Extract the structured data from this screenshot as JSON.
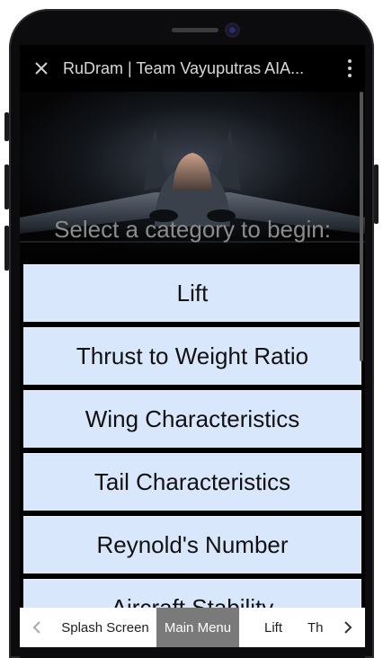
{
  "app_bar": {
    "title": "RuDram | Team Vayuputras AIA...",
    "close_icon": "close-icon",
    "menu_icon": "more-vert-icon"
  },
  "hero": {
    "image": "fighter-jet-image"
  },
  "prompt": "Select a category to begin:",
  "categories": [
    "Lift",
    "Thrust to Weight Ratio",
    "Wing Characteristics",
    "Tail Characteristics",
    "Reynold's Number",
    "Aircraft Stability"
  ],
  "tabs": {
    "items": [
      "Splash Screen",
      "Main Menu",
      "Lift",
      "Th"
    ],
    "active": "Main Menu",
    "prev_icon": "chevron-left-icon",
    "next_icon": "chevron-right-icon"
  },
  "colors": {
    "button_bg": "#d9e7fc",
    "active_tab": "#7a7a7a",
    "background": "#000000"
  }
}
